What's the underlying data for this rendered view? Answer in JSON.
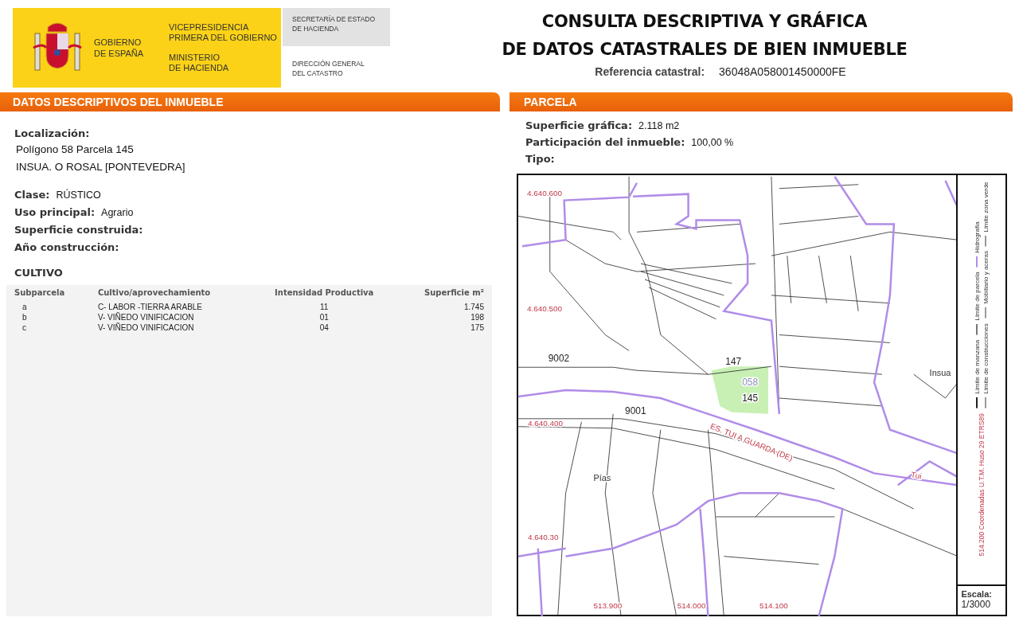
{
  "header": {
    "logo": {
      "government_lines": [
        "GOBIERNO",
        "DE ESPAÑA"
      ],
      "vicepresidency_lines": [
        "VICEPRESIDENCIA",
        "PRIMERA DEL GOBIERNO"
      ],
      "ministry_lines": [
        "MINISTERIO",
        "DE HACIENDA"
      ],
      "secretary_lines": [
        "SECRETARÍA DE ESTADO",
        "DE HACIENDA"
      ],
      "directorate_lines": [
        "DIRECCIÓN GENERAL",
        "DEL CATASTRO"
      ]
    },
    "title_lines": [
      "CONSULTA DESCRIPTIVA Y GRÁFICA",
      "DE DATOS CATASTRALES DE BIEN INMUEBLE"
    ],
    "reference": {
      "label": "Referencia catastral:",
      "value": "36048A058001450000FE"
    }
  },
  "descriptive": {
    "title": "DATOS DESCRIPTIVOS DEL INMUEBLE",
    "location_label": "Localización:",
    "location_lines": [
      "Polígono 58 Parcela 145",
      "INSUA. O ROSAL [PONTEVEDRA]"
    ],
    "fields": [
      {
        "label": "Clase:",
        "value": "RÚSTICO"
      },
      {
        "label": "Uso principal:",
        "value": "Agrario"
      },
      {
        "label": "Superficie construida:"
      },
      {
        "label": "Año construcción:"
      }
    ],
    "cultivo": {
      "title": "CULTIVO",
      "columns": [
        "Subparcela",
        "Cultivo/aprovechamiento",
        "Intensidad Productiva",
        "Superficie m²"
      ],
      "rows": [
        [
          "a",
          "C- LABOR -TIERRA ARABLE",
          "11",
          "1.745"
        ],
        [
          "b",
          "V- VIÑEDO VINIFICACION",
          "01",
          "198"
        ],
        [
          "c",
          "V- VIÑEDO VINIFICACION",
          "04",
          "175"
        ]
      ]
    }
  },
  "parcel": {
    "title": "PARCELA",
    "fields": [
      {
        "label": "Superficie gráfica:",
        "value": "2.118 m2"
      },
      {
        "label": "Participación del inmueble:",
        "value": "100,00 %"
      },
      {
        "label": "Tipo:"
      }
    ],
    "map": {
      "labels": [
        {
          "text": "4.640.600",
          "kind": "coordinate"
        },
        {
          "text": "4.640.500",
          "kind": "coordinate"
        },
        {
          "text": "4.640.400",
          "kind": "coordinate"
        },
        {
          "text": "4.640.30",
          "kind": "coordinate"
        },
        {
          "text": "513.900",
          "kind": "coordinate"
        },
        {
          "text": "514.000",
          "kind": "coordinate"
        },
        {
          "text": "514.100",
          "kind": "coordinate"
        },
        {
          "text": "9002",
          "kind": "parcel"
        },
        {
          "text": "147",
          "kind": "parcel"
        },
        {
          "text": "058",
          "kind": "polygon"
        },
        {
          "text": "145",
          "kind": "parcel"
        },
        {
          "text": "9001",
          "kind": "parcel"
        },
        {
          "text": "Insua",
          "kind": "place"
        },
        {
          "text": "Pías",
          "kind": "place"
        },
        {
          "text": "ES. TUI A GUARDA (DE)",
          "kind": "road"
        },
        {
          "text": "Tui",
          "kind": "road"
        }
      ],
      "legend_columns": [
        [
          "Límite de manzana",
          "Límite de parcela",
          "Hidrografía"
        ],
        [
          "Límite de construcciones",
          "Mobiliario y aceras",
          "Límite zona verde"
        ]
      ],
      "coordinates_note": "514.200 Coordenadas U.T.M. Huso 29 ETRS89",
      "scale_label": "Escala:",
      "scale_value": "1/3000"
    }
  }
}
